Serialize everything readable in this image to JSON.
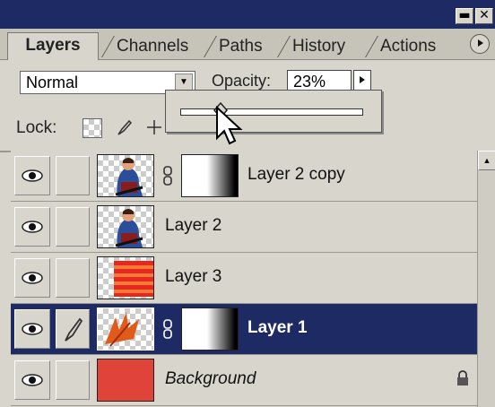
{
  "window": {
    "min_glyph": "▬",
    "close_glyph": "✕"
  },
  "tabs": [
    {
      "label": "Layers",
      "active": true
    },
    {
      "label": "Channels",
      "active": false
    },
    {
      "label": "Paths",
      "active": false
    },
    {
      "label": "History",
      "active": false
    },
    {
      "label": "Actions",
      "active": false
    }
  ],
  "options": {
    "blend_mode": "Normal",
    "opacity_label": "Opacity:",
    "opacity_value": "23%",
    "opacity_fraction": 0.23,
    "lock_label": "Lock:"
  },
  "layers": [
    {
      "name": "Layer 2 copy",
      "has_mask": true,
      "selected": false,
      "italic": false,
      "thumb": "person"
    },
    {
      "name": "Layer 2",
      "has_mask": false,
      "selected": false,
      "italic": false,
      "thumb": "person"
    },
    {
      "name": "Layer 3",
      "has_mask": false,
      "selected": false,
      "italic": false,
      "thumb": "red-stripes"
    },
    {
      "name": "Layer 1",
      "has_mask": true,
      "selected": true,
      "italic": false,
      "thumb": "leaf"
    },
    {
      "name": "Background",
      "has_mask": false,
      "selected": false,
      "italic": true,
      "thumb": "solid-red",
      "locked": true
    }
  ],
  "colors": {
    "titlebar": "#1d2a63",
    "selected_row": "#1d2a63",
    "panel": "#d8d5cc",
    "background_fill": "#e04438"
  }
}
